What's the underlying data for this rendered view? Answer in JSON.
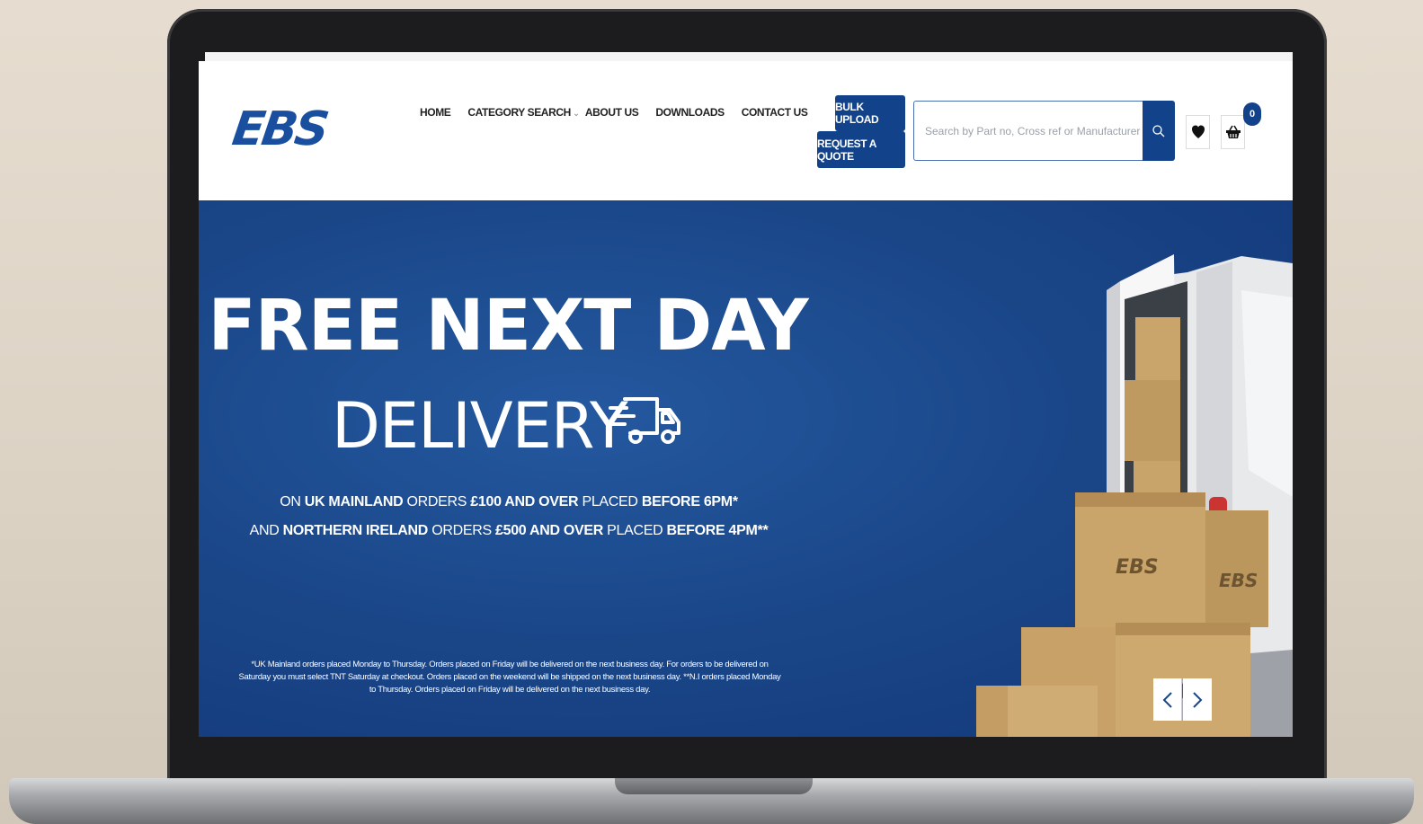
{
  "brand": {
    "logo_text": "EBS",
    "accent": "#12428a",
    "hero_bg": "#1a4688"
  },
  "nav": {
    "items": [
      {
        "label": "HOME"
      },
      {
        "label": "CATEGORY SEARCH"
      },
      {
        "label": "ABOUT US"
      },
      {
        "label": "DOWNLOADS"
      },
      {
        "label": "CONTACT US"
      }
    ]
  },
  "actions": {
    "bulk_upload": "BULK UPLOAD",
    "request_quote": "REQUEST A QUOTE"
  },
  "search": {
    "placeholder": "Search by Part no, Cross ref or Manufacturer",
    "value": ""
  },
  "cart": {
    "count": "0"
  },
  "hero": {
    "headline_line1": "FREE NEXT DAY",
    "headline_line2": "DELIVERY",
    "line1": {
      "p1": "ON ",
      "b1": "UK MAINLAND",
      "p2": " ORDERS ",
      "b2": "£100 AND OVER",
      "p3": " PLACED ",
      "b3": "BEFORE 6PM*"
    },
    "line2": {
      "p1": "AND ",
      "b1": "NORTHERN IRELAND",
      "p2": " ORDERS ",
      "b2": "£500 AND OVER",
      "p3": " PLACED ",
      "b3": "BEFORE 4PM**"
    },
    "fine_print": "*UK Mainland orders placed Monday to Thursday. Orders placed on Friday will be delivered on the next business day. For orders to be delivered on Saturday you must select TNT Saturday at checkout. Orders placed on the weekend will be shipped on the next business day. **N.I orders placed Monday to Thursday. Orders placed on Friday will be delivered on the next business day.",
    "box_label": "EBS"
  },
  "icons": {
    "search": "search-icon",
    "wishlist": "heart-icon",
    "basket": "basket-icon",
    "truck": "delivery-truck-icon",
    "prev": "chevron-left-icon",
    "next": "chevron-right-icon"
  }
}
